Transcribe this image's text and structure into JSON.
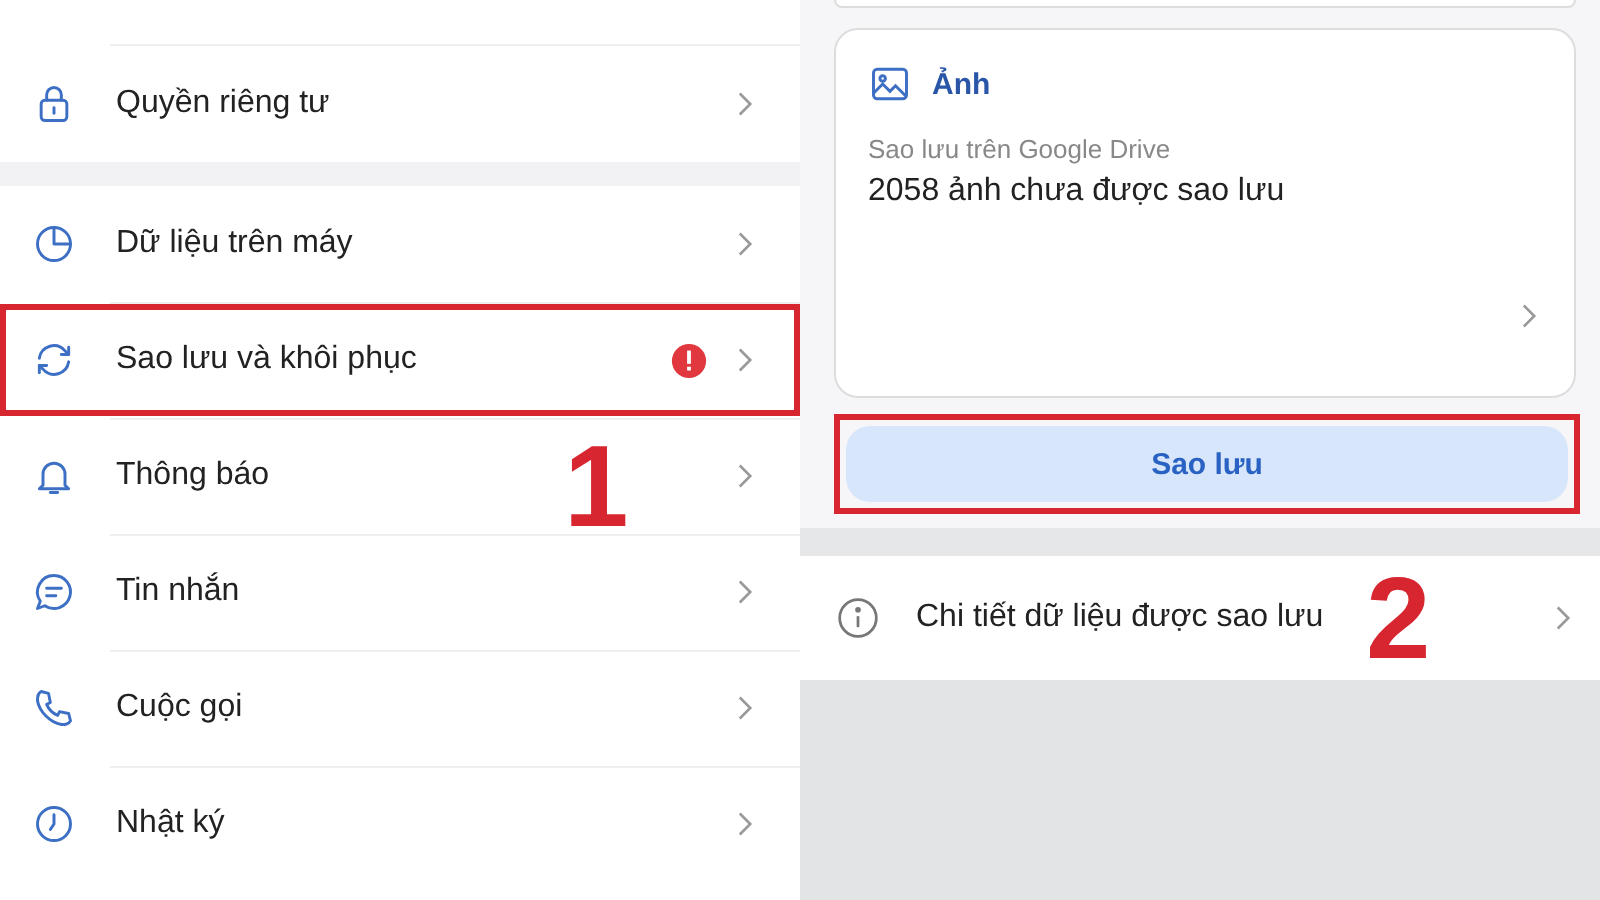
{
  "settings_list": {
    "groups": [
      {
        "items": [
          {
            "label": "Quyền riêng tư",
            "alert": false,
            "highlighted": false
          }
        ]
      },
      {
        "items": [
          {
            "label": "Dữ liệu trên máy",
            "alert": false,
            "highlighted": false
          },
          {
            "label": "Sao lưu và khôi phục",
            "alert": true,
            "highlighted": true
          },
          {
            "label": "Thông báo",
            "alert": false,
            "highlighted": false
          },
          {
            "label": "Tin nhắn",
            "alert": false,
            "highlighted": false
          },
          {
            "label": "Cuộc gọi",
            "alert": false,
            "highlighted": false
          },
          {
            "label": "Nhật ký",
            "alert": false,
            "highlighted": false
          }
        ]
      }
    ],
    "step_number": "1"
  },
  "backup_screen": {
    "photos_card": {
      "title": "Ảnh",
      "subtitle": "Sao lưu trên Google Drive",
      "status": "2058 ảnh chưa được sao lưu"
    },
    "backup_button": {
      "label": "Sao lưu",
      "highlighted": true
    },
    "details_row": {
      "label": "Chi tiết dữ liệu được sao lưu"
    },
    "step_number": "2"
  }
}
